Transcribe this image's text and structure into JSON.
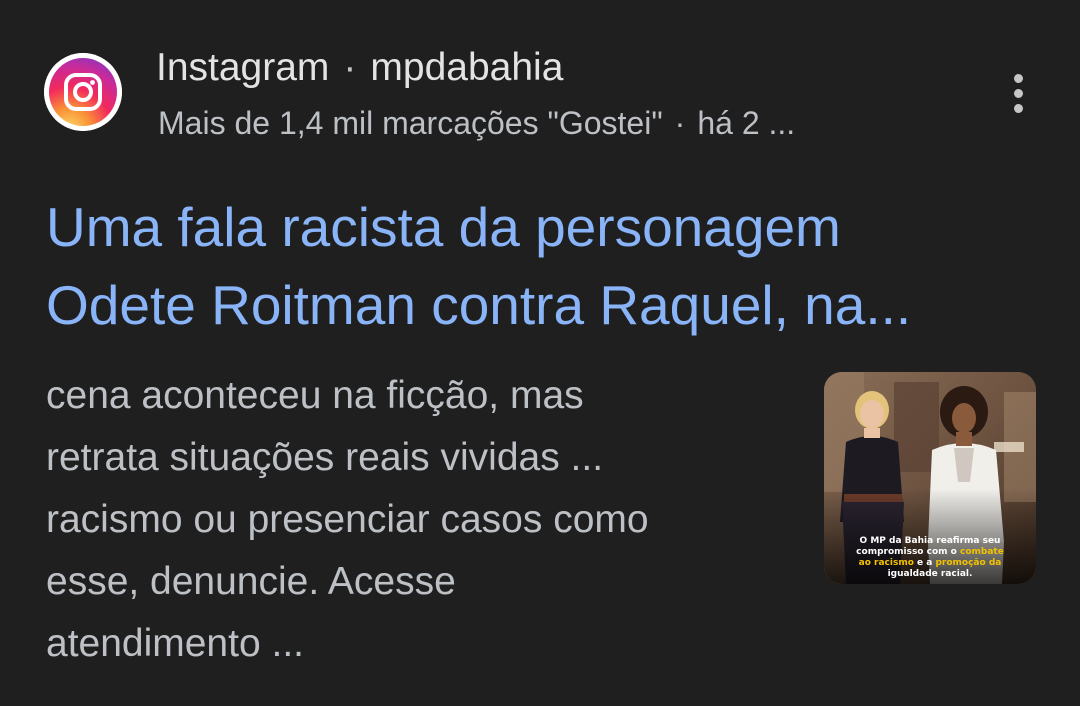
{
  "result": {
    "source_name": "Instagram",
    "source_separator": "·",
    "account": "mpdabahia",
    "likes_text": "Mais de 1,4 mil marcações \"Gostei\"",
    "meta_separator": "·",
    "date_text": "há 2 ...",
    "title_line1": "Uma fala racista da personagem",
    "title_line2": "Odete Roitman contra Raquel, na...",
    "snippet_lines": [
      "cena aconteceu na ficção, mas",
      "retrata situações reais vividas ...",
      "racismo ou presenciar casos como",
      "esse, denuncie. Acesse",
      "atendimento ..."
    ],
    "thumbnail": {
      "caption_line1": "O MP da Bahia reafirma seu",
      "caption_line2a": "compromisso com o ",
      "caption_line2b": "combate",
      "caption_line3a": "ao racismo",
      "caption_line3b": " e a ",
      "caption_line3c": "promoção da",
      "caption_line4": "igualdade racial."
    }
  },
  "icons": {
    "site_logo": "instagram-logo-icon",
    "more": "more-vert-icon"
  },
  "colors": {
    "background": "#1f1f1f",
    "title_link": "#8ab4f8",
    "text_primary": "#e3e3e3",
    "text_secondary": "#bdc1c6",
    "caption_highlight": "#f2c200"
  }
}
